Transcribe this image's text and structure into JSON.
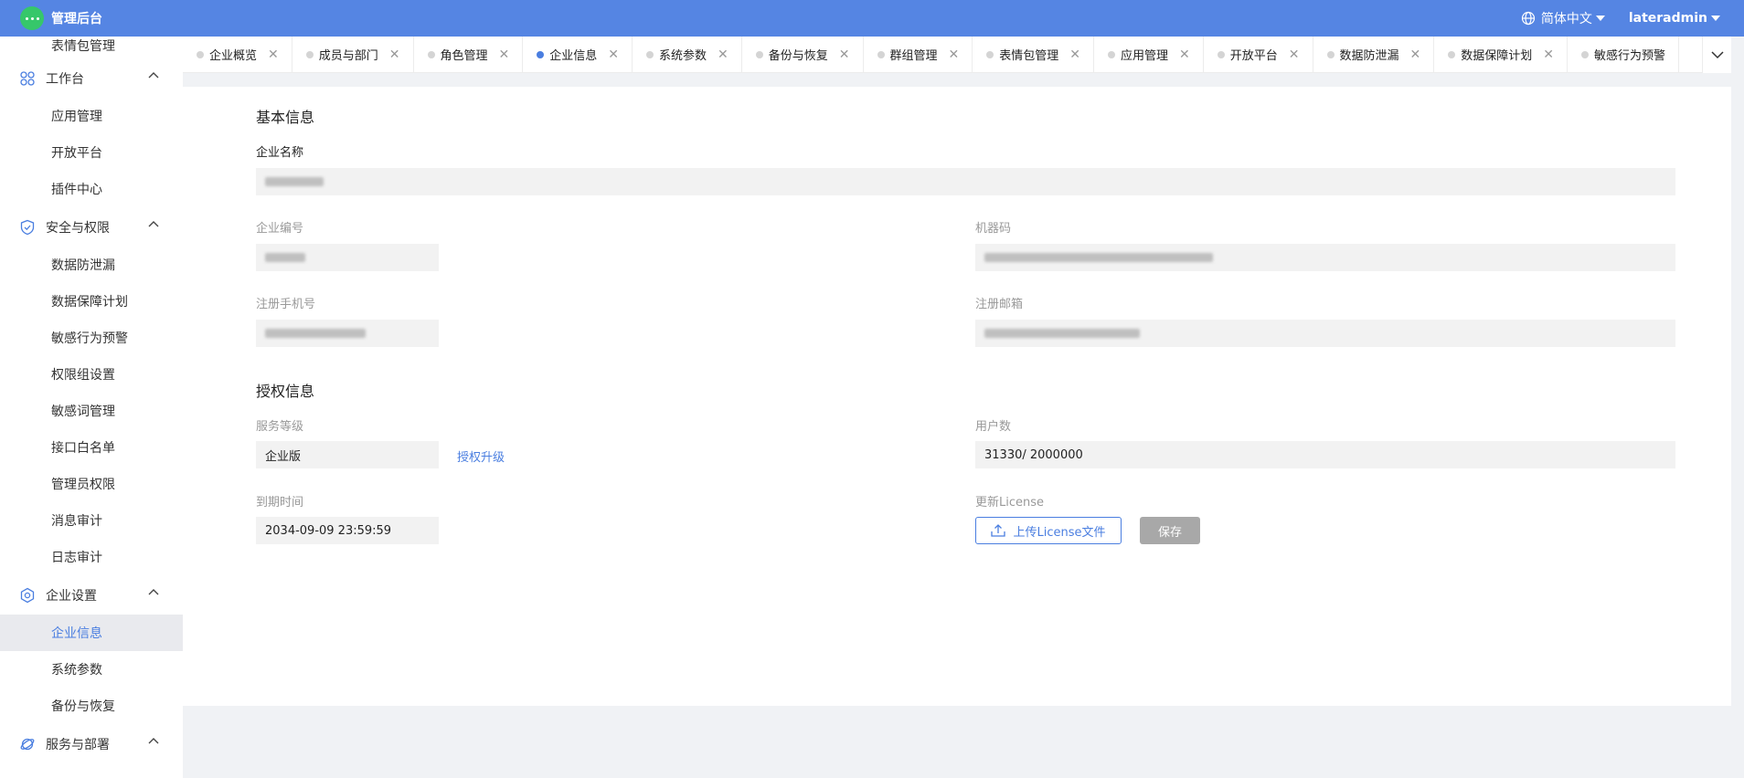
{
  "header": {
    "app_title": "管理后台",
    "language": "简体中文",
    "username": "lateradmin"
  },
  "sidebar": {
    "top_item": "表情包管理",
    "groups": [
      {
        "label": "工作台",
        "icon": "grid-icon",
        "items": [
          "应用管理",
          "开放平台",
          "插件中心"
        ]
      },
      {
        "label": "安全与权限",
        "icon": "shield-icon",
        "items": [
          "数据防泄漏",
          "数据保障计划",
          "敏感行为预警",
          "权限组设置",
          "敏感词管理",
          "接口白名单",
          "管理员权限",
          "消息审计",
          "日志审计"
        ]
      },
      {
        "label": "企业设置",
        "icon": "settings-icon",
        "items": [
          "企业信息",
          "系统参数",
          "备份与恢复"
        ]
      },
      {
        "label": "服务与部署",
        "icon": "planet-icon",
        "items": []
      }
    ],
    "active_item": "企业信息"
  },
  "tabs": [
    {
      "label": "企业概览"
    },
    {
      "label": "成员与部门"
    },
    {
      "label": "角色管理"
    },
    {
      "label": "企业信息",
      "active": true
    },
    {
      "label": "系统参数"
    },
    {
      "label": "备份与恢复"
    },
    {
      "label": "群组管理"
    },
    {
      "label": "表情包管理"
    },
    {
      "label": "应用管理"
    },
    {
      "label": "开放平台"
    },
    {
      "label": "数据防泄漏"
    },
    {
      "label": "数据保障计划"
    },
    {
      "label": "敏感行为预警"
    }
  ],
  "basic_info": {
    "title": "基本信息",
    "company_name_label": "企业名称",
    "company_id_label": "企业编号",
    "machine_code_label": "机器码",
    "phone_label": "注册手机号",
    "email_label": "注册邮箱"
  },
  "license_info": {
    "title": "授权信息",
    "service_level_label": "服务等级",
    "service_level_value": "企业版",
    "upgrade_link": "授权升级",
    "user_count_label": "用户数",
    "user_count_value": "31330/ 2000000",
    "expire_label": "到期时间",
    "expire_value": "2034-09-09 23:59:59",
    "update_license_label": "更新License",
    "upload_button": "上传License文件",
    "save_button": "保存"
  },
  "colors": {
    "header_bg": "#5585e3",
    "accent": "#4a7ee0",
    "logo": "#36c76a"
  }
}
